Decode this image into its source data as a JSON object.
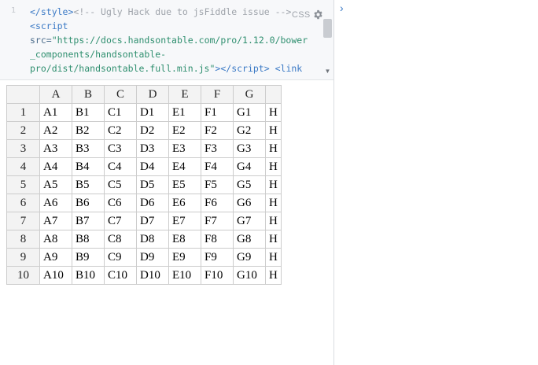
{
  "editor": {
    "line_number": "1",
    "lines": [
      [
        {
          "t": "</",
          "c": "c-tag"
        },
        {
          "t": "style",
          "c": "c-tag"
        },
        {
          "t": ">",
          "c": "c-tag"
        },
        {
          "t": "<!-- Ugly Hack due to jsFiddle issue -->",
          "c": "c-comment"
        }
      ],
      [
        {
          "t": "<",
          "c": "c-tag"
        },
        {
          "t": "script",
          "c": "c-tag"
        }
      ],
      [
        {
          "t": "src",
          "c": "c-attr"
        },
        {
          "t": "=",
          "c": "c-attr"
        },
        {
          "t": "\"https://docs.handsontable.com/pro/1.12.0/bower",
          "c": "c-str"
        }
      ],
      [
        {
          "t": "_components/handsontable-",
          "c": "c-str"
        }
      ],
      [
        {
          "t": "pro/dist/handsontable.full.min.js\"",
          "c": "c-str"
        },
        {
          "t": "></",
          "c": "c-tag"
        },
        {
          "t": "script",
          "c": "c-tag"
        },
        {
          "t": "> ",
          "c": "c-tag"
        },
        {
          "t": "<link",
          "c": "c-tag"
        }
      ]
    ],
    "mode_label": "CSS",
    "settings_icon": "gear-icon",
    "collapse_icon": "chevron-right-icon"
  },
  "grid": {
    "columns": [
      "A",
      "B",
      "C",
      "D",
      "E",
      "F",
      "G",
      ""
    ],
    "rows": [
      {
        "header": "1",
        "cells": [
          "A1",
          "B1",
          "C1",
          "D1",
          "E1",
          "F1",
          "G1",
          "H"
        ]
      },
      {
        "header": "2",
        "cells": [
          "A2",
          "B2",
          "C2",
          "D2",
          "E2",
          "F2",
          "G2",
          "H"
        ]
      },
      {
        "header": "3",
        "cells": [
          "A3",
          "B3",
          "C3",
          "D3",
          "E3",
          "F3",
          "G3",
          "H"
        ]
      },
      {
        "header": "4",
        "cells": [
          "A4",
          "B4",
          "C4",
          "D4",
          "E4",
          "F4",
          "G4",
          "H"
        ]
      },
      {
        "header": "5",
        "cells": [
          "A5",
          "B5",
          "C5",
          "D5",
          "E5",
          "F5",
          "G5",
          "H"
        ]
      },
      {
        "header": "6",
        "cells": [
          "A6",
          "B6",
          "C6",
          "D6",
          "E6",
          "F6",
          "G6",
          "H"
        ]
      },
      {
        "header": "7",
        "cells": [
          "A7",
          "B7",
          "C7",
          "D7",
          "E7",
          "F7",
          "G7",
          "H"
        ]
      },
      {
        "header": "8",
        "cells": [
          "A8",
          "B8",
          "C8",
          "D8",
          "E8",
          "F8",
          "G8",
          "H"
        ]
      },
      {
        "header": "9",
        "cells": [
          "A9",
          "B9",
          "C9",
          "D9",
          "E9",
          "F9",
          "G9",
          "H"
        ]
      },
      {
        "header": "10",
        "cells": [
          "A10",
          "B10",
          "C10",
          "D10",
          "E10",
          "F10",
          "G10",
          "H"
        ]
      }
    ]
  }
}
